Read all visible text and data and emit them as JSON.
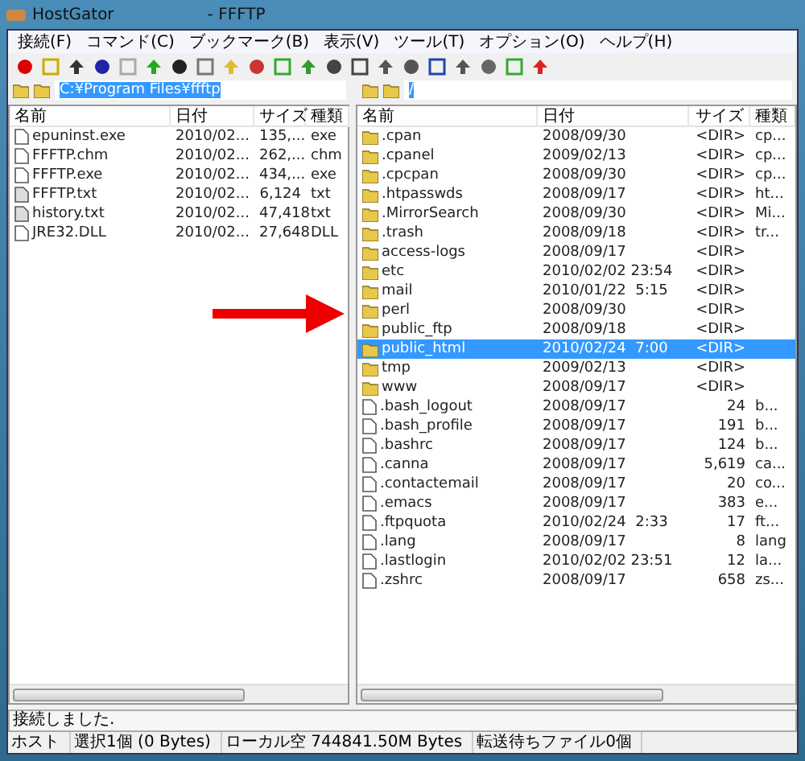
{
  "window": {
    "title": "HostGator",
    "title_suffix": "- FFFTP"
  },
  "menu": [
    "接続(F)",
    "コマンド(C)",
    "ブックマーク(B)",
    "表示(V)",
    "ツール(T)",
    "オプション(O)",
    "ヘルプ(H)"
  ],
  "local": {
    "path": "C:¥Program Files¥ffftp",
    "columns": [
      "名前",
      "日付",
      "サイズ",
      "種類"
    ],
    "rows": [
      {
        "kind": "file",
        "name": "epuninst.exe",
        "date": "2010/02...",
        "size": "135,...",
        "type": "exe",
        "selected": false
      },
      {
        "kind": "file",
        "name": "FFFTP.chm",
        "date": "2010/02...",
        "size": "262,...",
        "type": "chm",
        "selected": false
      },
      {
        "kind": "file",
        "name": "FFFTP.exe",
        "date": "2010/02...",
        "size": "434,...",
        "type": "exe",
        "selected": false
      },
      {
        "kind": "text",
        "name": "FFFTP.txt",
        "date": "2010/02...",
        "size": "6,124",
        "type": "txt",
        "selected": false
      },
      {
        "kind": "text",
        "name": "history.txt",
        "date": "2010/02...",
        "size": "47,418",
        "type": "txt",
        "selected": false
      },
      {
        "kind": "file",
        "name": "JRE32.DLL",
        "date": "2010/02...",
        "size": "27,648",
        "type": "DLL",
        "selected": false
      }
    ]
  },
  "remote": {
    "path": "/",
    "columns": [
      "名前",
      "日付",
      "サイズ",
      "種類"
    ],
    "rows": [
      {
        "kind": "folder",
        "name": ".cpan",
        "date": "2008/09/30",
        "size": "<DIR>",
        "type": "cp...",
        "selected": false
      },
      {
        "kind": "folder",
        "name": ".cpanel",
        "date": "2009/02/13",
        "size": "<DIR>",
        "type": "cp...",
        "selected": false
      },
      {
        "kind": "folder",
        "name": ".cpcpan",
        "date": "2008/09/30",
        "size": "<DIR>",
        "type": "cp...",
        "selected": false
      },
      {
        "kind": "folder",
        "name": ".htpasswds",
        "date": "2008/09/17",
        "size": "<DIR>",
        "type": "ht...",
        "selected": false
      },
      {
        "kind": "folder",
        "name": ".MirrorSearch",
        "date": "2008/09/30",
        "size": "<DIR>",
        "type": "Mi...",
        "selected": false
      },
      {
        "kind": "folder",
        "name": ".trash",
        "date": "2008/09/18",
        "size": "<DIR>",
        "type": "tr...",
        "selected": false
      },
      {
        "kind": "folder",
        "name": "access-logs",
        "date": "2008/09/17",
        "size": "<DIR>",
        "selected": false
      },
      {
        "kind": "folder",
        "name": "etc",
        "date": "2010/02/02 23:54",
        "size": "<DIR>",
        "selected": false
      },
      {
        "kind": "folder",
        "name": "mail",
        "date": "2010/01/22  5:15",
        "size": "<DIR>",
        "selected": false
      },
      {
        "kind": "folder",
        "name": "perl",
        "date": "2008/09/30",
        "size": "<DIR>",
        "selected": false
      },
      {
        "kind": "folder",
        "name": "public_ftp",
        "date": "2008/09/18",
        "size": "<DIR>",
        "selected": false
      },
      {
        "kind": "folder",
        "name": "public_html",
        "date": "2010/02/24  7:00",
        "size": "<DIR>",
        "selected": true
      },
      {
        "kind": "folder",
        "name": "tmp",
        "date": "2009/02/13",
        "size": "<DIR>",
        "selected": false
      },
      {
        "kind": "folder",
        "name": "www",
        "date": "2008/09/17",
        "size": "<DIR>",
        "selected": false
      },
      {
        "kind": "file",
        "name": ".bash_logout",
        "date": "2008/09/17",
        "size": "24",
        "type": "b...",
        "selected": false
      },
      {
        "kind": "file",
        "name": ".bash_profile",
        "date": "2008/09/17",
        "size": "191",
        "type": "b...",
        "selected": false
      },
      {
        "kind": "file",
        "name": ".bashrc",
        "date": "2008/09/17",
        "size": "124",
        "type": "b...",
        "selected": false
      },
      {
        "kind": "file",
        "name": ".canna",
        "date": "2008/09/17",
        "size": "5,619",
        "type": "ca...",
        "selected": false
      },
      {
        "kind": "file",
        "name": ".contactemail",
        "date": "2008/09/17",
        "size": "20",
        "type": "co...",
        "selected": false
      },
      {
        "kind": "file",
        "name": ".emacs",
        "date": "2008/09/17",
        "size": "383",
        "type": "e...",
        "selected": false
      },
      {
        "kind": "file",
        "name": ".ftpquota",
        "date": "2010/02/24  2:33",
        "size": "17",
        "type": "ft...",
        "selected": false
      },
      {
        "kind": "file",
        "name": ".lang",
        "date": "2008/09/17",
        "size": "8",
        "type": "lang",
        "selected": false
      },
      {
        "kind": "file",
        "name": ".lastlogin",
        "date": "2010/02/02 23:51",
        "size": "12",
        "type": "la...",
        "selected": false
      },
      {
        "kind": "file",
        "name": ".zshrc",
        "date": "2008/09/17",
        "size": "658",
        "type": "zs...",
        "selected": false
      }
    ]
  },
  "log": "接続しました.",
  "status_bar": [
    "ホスト",
    "選択1個 (0 Bytes)",
    "ローカル空 744841.50M Bytes",
    "転送待ちファイル0個"
  ]
}
